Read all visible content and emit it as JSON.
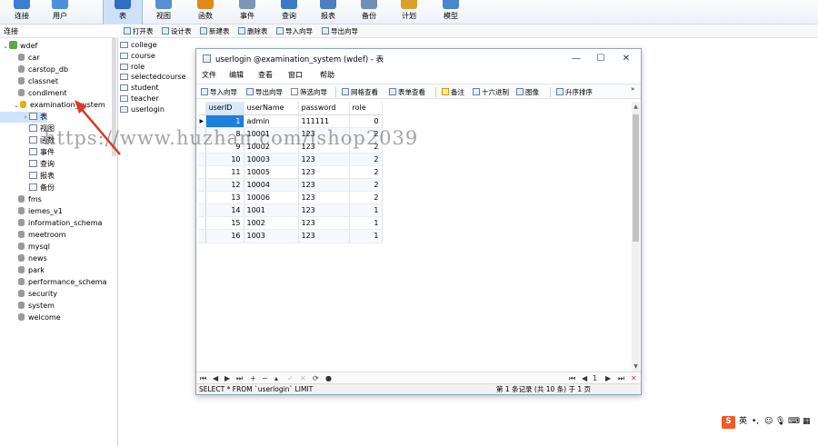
{
  "toolbar": {
    "items": [
      {
        "label": "连接",
        "icon": "connection-icon",
        "active": false
      },
      {
        "label": "用户",
        "icon": "user-icon",
        "active": false
      },
      {
        "label": "表",
        "icon": "table-icon",
        "active": true
      },
      {
        "label": "视图",
        "icon": "view-icon",
        "active": false
      },
      {
        "label": "函数",
        "icon": "function-icon",
        "active": false
      },
      {
        "label": "事件",
        "icon": "event-icon",
        "active": false
      },
      {
        "label": "查询",
        "icon": "query-icon",
        "active": false
      },
      {
        "label": "报表",
        "icon": "report-icon",
        "active": false
      },
      {
        "label": "备份",
        "icon": "backup-icon",
        "active": false
      },
      {
        "label": "计划",
        "icon": "schedule-icon",
        "active": false
      },
      {
        "label": "模型",
        "icon": "model-icon",
        "active": false
      }
    ]
  },
  "sidebar": {
    "header": "连接",
    "connection": "wdef",
    "databases_before": [
      "car",
      "carstop_db",
      "classnet",
      "condiment"
    ],
    "open_database": "examination_system",
    "objects": [
      "表",
      "视图",
      "函数",
      "事件",
      "查询",
      "报表",
      "备份"
    ],
    "databases_after": [
      "fms",
      "iemes_v1",
      "information_schema",
      "meetroom",
      "mysql",
      "news",
      "park",
      "performance_schema",
      "security",
      "system",
      "welcome"
    ]
  },
  "object_toolbar": {
    "open": "打开表",
    "design": "设计表",
    "new": "新建表",
    "delete": "删除表",
    "import": "导入向导",
    "export": "导出向导"
  },
  "tables": [
    "college",
    "course",
    "role",
    "selectedcourse",
    "student",
    "teacher",
    "userlogin"
  ],
  "watermark": "https://www.huzhan.com/ishop2039",
  "window": {
    "title": "userlogin @examination_system (wdef) - 表",
    "controls": {
      "minimize": "—",
      "maximize": "☐",
      "close": "✕"
    },
    "menu": [
      "文件",
      "编辑",
      "查看",
      "窗口",
      "帮助"
    ],
    "toolbar": {
      "import": "导入向导",
      "export": "导出向导",
      "filter": "筛选向导",
      "grid_view": "网格查看",
      "form_view": "表单查看",
      "memo": "备注",
      "hex": "十六进制",
      "image": "图像",
      "sort": "升序排序"
    },
    "columns": [
      "userID",
      "userName",
      "password",
      "role"
    ],
    "rows": [
      [
        "1",
        "admin",
        "111111",
        "0"
      ],
      [
        "8",
        "10001",
        "123",
        "2"
      ],
      [
        "9",
        "10002",
        "123",
        "2"
      ],
      [
        "10",
        "10003",
        "123",
        "2"
      ],
      [
        "11",
        "10005",
        "123",
        "2"
      ],
      [
        "12",
        "10004",
        "123",
        "2"
      ],
      [
        "13",
        "10006",
        "123",
        "2"
      ],
      [
        "14",
        "1001",
        "123",
        "1"
      ],
      [
        "15",
        "1002",
        "123",
        "1"
      ],
      [
        "16",
        "1003",
        "123",
        "1"
      ]
    ],
    "sql": "SELECT * FROM `userlogin` LIMIT",
    "status": "第 1 条记录 (共 10 条) 于 1 页",
    "page": "1"
  },
  "tray": {
    "ime": "S",
    "lang": "英"
  }
}
